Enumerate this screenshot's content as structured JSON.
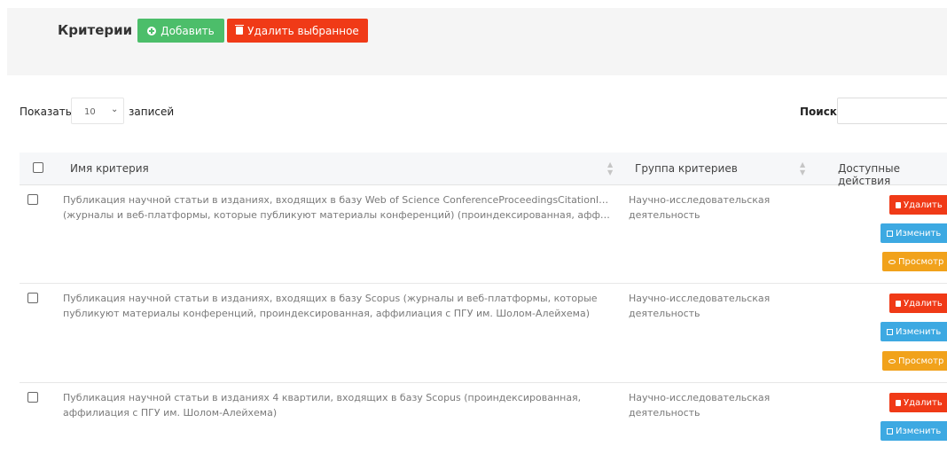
{
  "header": {
    "title": "Критерии",
    "add_label": "Добавить",
    "delete_selected_label": "Удалить выбранное"
  },
  "controls": {
    "show_label": "Показать",
    "length_value": "10",
    "records_label": "записей",
    "search_label": "Поиск:"
  },
  "table": {
    "columns": [
      "Имя критерия",
      "Группа критериев",
      "Доступные действия"
    ],
    "actions": {
      "delete": "Удалить",
      "edit": "Изменить",
      "view": "Просмотр"
    },
    "rows": [
      {
        "name_line1": "Публикация научной статьи в изданиях, входящих в базу Web of Science ConferenceProceedingsCitationIndex",
        "name_line2": "(журналы и веб-платформы, которые публикуют материалы конференций) (проиндексированная, аффилиац ...",
        "group_line1": "Научно-исследовательская",
        "group_line2": "деятельность"
      },
      {
        "name_line1": "Публикация научной статьи в изданиях, входящих в базу Scopus (журналы и веб-платформы, которые",
        "name_line2": "публикуют материалы конференций, проиндексированная, аффилиация с ПГУ им. Шолом-Алейхема)",
        "group_line1": "Научно-исследовательская",
        "group_line2": "деятельность"
      },
      {
        "name_line1": "Публикация научной статьи в изданиях 4 квартили, входящих в базу Scopus (проиндексированная,",
        "name_line2": "аффилиация с ПГУ им. Шолом-Алейхема)",
        "group_line1": "Научно-исследовательская",
        "group_line2": "деятельность"
      }
    ]
  },
  "colors": {
    "add": "#4cbe6a",
    "delete": "#f03a17",
    "edit": "#3da9e2",
    "view": "#f1a21b"
  }
}
